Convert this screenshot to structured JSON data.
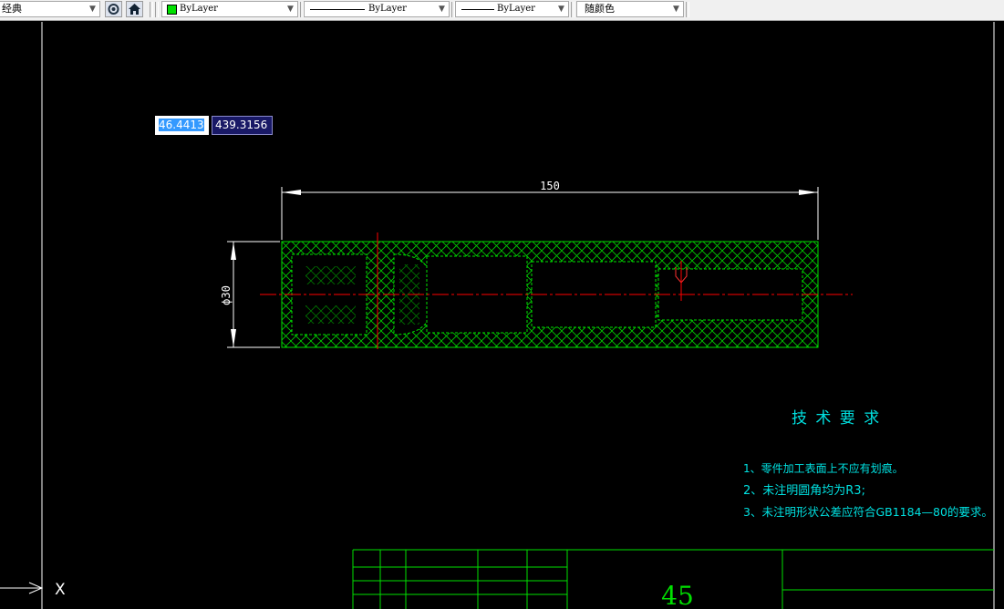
{
  "toolbar": {
    "workspace": "经典",
    "layer_color": "ByLayer",
    "linetype": "ByLayer",
    "lineweight": "ByLayer",
    "plot_style": "随颜色",
    "accent_color": "#00e000"
  },
  "coords": {
    "x": "46.4413",
    "y": "439.3156"
  },
  "drawing": {
    "dim_length": "150",
    "dim_diameter": "ϕ30"
  },
  "tech": {
    "title": "技 术 要 求",
    "notes": [
      "1、零件加工表面上不应有划痕。",
      "2、未注明圆角均为R3;",
      "3、未注明形状公差应符合GB1184—80的要求。"
    ]
  },
  "title_block": {
    "material": "45"
  },
  "ucs": {
    "x_label": "X"
  },
  "colors": {
    "geometry": "#00e000",
    "dimension": "#ffffff",
    "centerline": "#ff0000",
    "annotation": "#00e0e0"
  }
}
